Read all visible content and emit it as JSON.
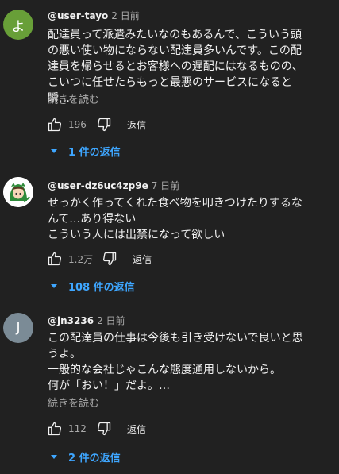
{
  "comments": [
    {
      "avatar_letter": "よ",
      "author": "@user-tayo",
      "time": "2 日前",
      "text": "配達員って派遣みたいなのもあるんで、こういう頭\nの悪い使い物にならない配達員多いんです。この配\n達員を帰らせるとお客様への遅配にはなるものの、\nこいつに任せたらもっと最悪のサービスになると瞬…",
      "read_more": "続きを読む",
      "likes": "196",
      "reply_label": "返信",
      "replies": "1 件の返信"
    },
    {
      "avatar_icon": "anime-character-avatar",
      "author": "@user-dz6uc4zp9e",
      "time": "7 日前",
      "text": "せっかく作ってくれた食べ物を叩きつけたりするな\nんて…あり得ない\nこういう人には出禁になって欲しい",
      "likes": "1.2万",
      "reply_label": "返信",
      "replies": "108 件の返信"
    },
    {
      "avatar_letter": "J",
      "author": "@jn3236",
      "time": "2 日前",
      "text": "この配達員の仕事は今後も引き受けないで良いと思\nうよ。\n一般的な会社じゃこんな態度通用しないから。\n何が「おい！」だよ。…",
      "read_more": "続きを読む",
      "likes": "112",
      "reply_label": "返信",
      "replies": "2 件の返信"
    }
  ],
  "colors": {
    "background": "#212121",
    "link_blue": "#3ea6ff",
    "avatar_green": "#689f38",
    "avatar_grey": "#7b8b96"
  }
}
